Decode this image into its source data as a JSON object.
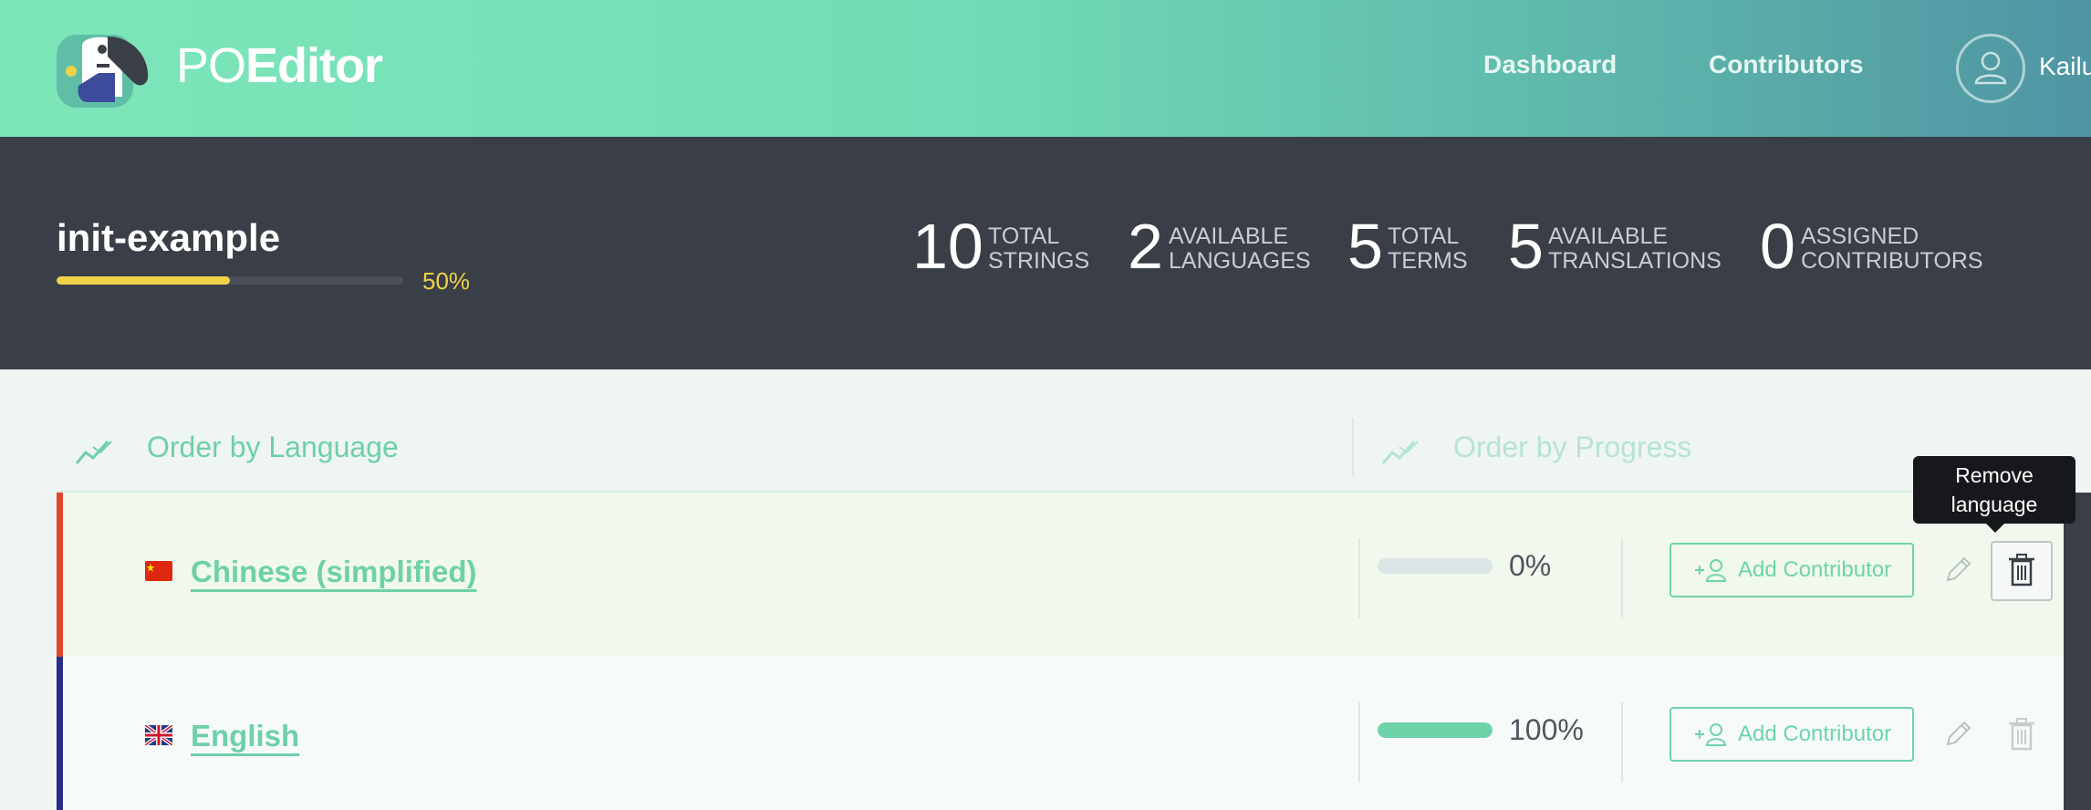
{
  "header": {
    "brand_light": "PO",
    "brand_bold": "Editor",
    "nav": [
      {
        "label": "Dashboard"
      },
      {
        "label": "Contributors"
      }
    ],
    "user_name": "Kailu"
  },
  "project": {
    "name": "init-example",
    "progress_percent": 50,
    "progress_label": "50%",
    "stats": [
      {
        "value": "10",
        "line1": "TOTAL",
        "line2": "STRINGS"
      },
      {
        "value": "2",
        "line1": "AVAILABLE",
        "line2": "LANGUAGES"
      },
      {
        "value": "5",
        "line1": "TOTAL",
        "line2": "TERMS"
      },
      {
        "value": "5",
        "line1": "AVAILABLE",
        "line2": "TRANSLATIONS"
      },
      {
        "value": "0",
        "line1": "ASSIGNED",
        "line2": "CONTRIBUTORS"
      }
    ]
  },
  "ordering": {
    "by_language": "Order by Language",
    "by_progress": "Order by Progress",
    "active_color": "#6fd0a8",
    "inactive_color": "#b7e3d3"
  },
  "languages": [
    {
      "name": "Chinese (simplified)",
      "flag_icon": "china-flag-icon",
      "accent": "#e0452e",
      "progress_percent": 0,
      "progress_label": "0%",
      "add_contributor_label": "Add Contributor"
    },
    {
      "name": "English",
      "flag_icon": "uk-flag-icon",
      "accent": "#2a2f86",
      "progress_percent": 100,
      "progress_label": "100%",
      "add_contributor_label": "Add Contributor"
    }
  ],
  "tooltip": {
    "line1": "Remove",
    "line2": "language"
  }
}
